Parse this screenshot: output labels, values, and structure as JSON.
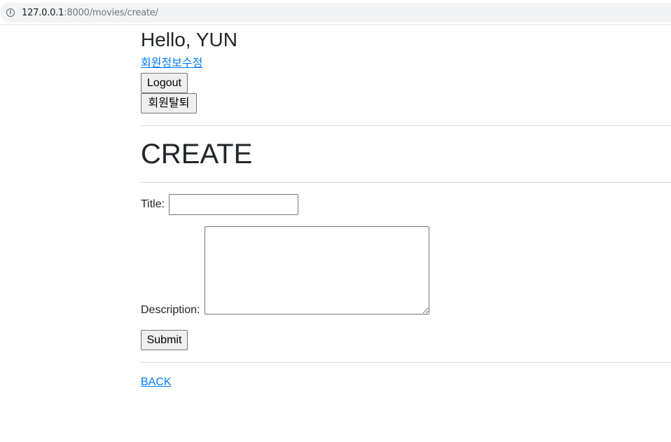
{
  "browser": {
    "url_host": "127.0.0.1",
    "url_path": ":8000/movies/create/",
    "info_icon": "info-icon"
  },
  "header": {
    "greeting": "Hello, YUN",
    "edit_profile_link": "회원정보수정",
    "logout_label": "Logout",
    "withdraw_label": "회원탈퇴"
  },
  "main": {
    "page_title": "CREATE",
    "form": {
      "title_label": "Title:",
      "title_value": "",
      "description_label": "Description:",
      "description_value": "",
      "submit_label": "Submit"
    },
    "back_link": "BACK"
  },
  "colors": {
    "link": "#007bff",
    "text": "#212529"
  }
}
